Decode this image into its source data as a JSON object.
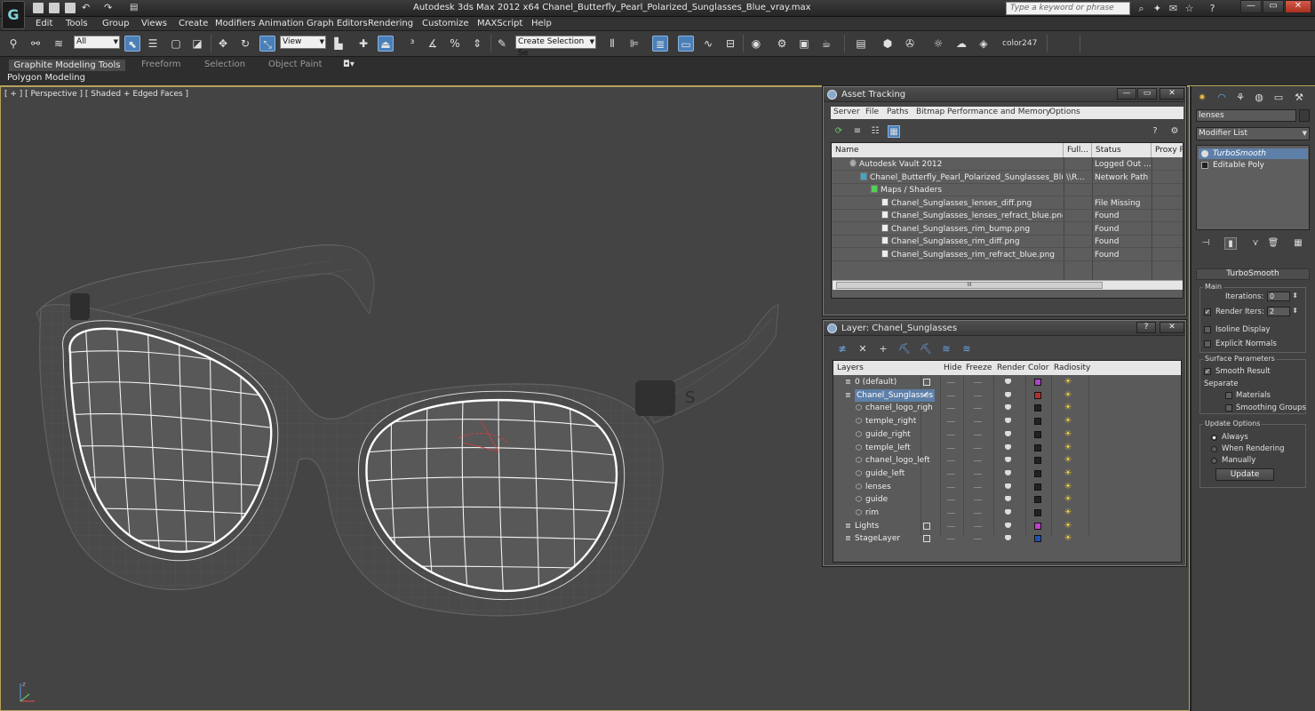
{
  "app": {
    "logo_text": "G",
    "window_title": "Autodesk 3ds Max  2012 x64      Chanel_Butterfly_Pearl_Polarized_Sunglasses_Blue_vray.max",
    "search_placeholder": "Type a keyword or phrase",
    "window_buttons": {
      "minimize": "—",
      "maximize": "▭",
      "close": "✕"
    }
  },
  "menu": [
    "Edit",
    "Tools",
    "Group",
    "Views",
    "Create",
    "Modifiers",
    "Animation",
    "Graph Editors",
    "Rendering",
    "Customize",
    "MAXScript",
    "Help"
  ],
  "toolbar": {
    "selection_filter": "All",
    "reference_coord": "View",
    "named_selection_set": "Create Selection Se",
    "color_label": "color247"
  },
  "ribbon": {
    "tabs": [
      "Graphite Modeling Tools",
      "Freeform",
      "Selection",
      "Object Paint"
    ],
    "active_tab": "Graphite Modeling Tools",
    "panel_label": "Polygon Modeling"
  },
  "viewport": {
    "label": "[ + ] [ Perspective ] [ Shaded + Edged Faces ]"
  },
  "command_panel": {
    "object_name": "lenses",
    "modifier_list_label": "Modifier List",
    "stack": [
      {
        "name": "TurboSmooth",
        "selected": true
      },
      {
        "name": "Editable Poly",
        "selected": false
      }
    ],
    "rollout_title": "TurboSmooth",
    "main_group": "Main",
    "iterations_label": "Iterations:",
    "iterations_value": "0",
    "render_iters_label": "Render Iters:",
    "render_iters_value": "2",
    "render_iters_checked": true,
    "isoline_label": "Isoline Display",
    "explicit_normals_label": "Explicit Normals",
    "surface_group": "Surface Parameters",
    "smooth_result_label": "Smooth Result",
    "separate_label": "Separate",
    "materials_label": "Materials",
    "smoothing_groups_label": "Smoothing Groups",
    "update_group": "Update Options",
    "update_options": [
      "Always",
      "When Rendering",
      "Manually"
    ],
    "update_selected": "Always",
    "update_button": "Update"
  },
  "asset_tracking": {
    "title": "Asset Tracking",
    "menu": [
      "Server",
      "File",
      "Paths",
      "Bitmap Performance and Memory",
      "Options"
    ],
    "columns": [
      "Name",
      "Full...",
      "Status",
      "Proxy R"
    ],
    "rows": [
      {
        "name": "Autodesk Vault 2012",
        "full": "",
        "status": "Logged Out ...",
        "indent": 1
      },
      {
        "name": "Chanel_Butterfly_Pearl_Polarized_Sunglasses_Blue_...",
        "full": "\\\\R...",
        "status": "Network Path",
        "indent": 2
      },
      {
        "name": "Maps / Shaders",
        "full": "",
        "status": "",
        "indent": 3
      },
      {
        "name": "Chanel_Sunglasses_lenses_diff.png",
        "full": "",
        "status": "File Missing",
        "indent": 4
      },
      {
        "name": "Chanel_Sunglasses_lenses_refract_blue.png",
        "full": "",
        "status": "Found",
        "indent": 4
      },
      {
        "name": "Chanel_Sunglasses_rim_bump.png",
        "full": "",
        "status": "Found",
        "indent": 4
      },
      {
        "name": "Chanel_Sunglasses_rim_diff.png",
        "full": "",
        "status": "Found",
        "indent": 4
      },
      {
        "name": "Chanel_Sunglasses_rim_refract_blue.png",
        "full": "",
        "status": "Found",
        "indent": 4
      }
    ],
    "scroll_thumb": "III"
  },
  "layer_dialog": {
    "title": "Layer: Chanel_Sunglasses",
    "columns": [
      "Layers",
      "Hide",
      "Freeze",
      "Render",
      "Color",
      "Radiosity"
    ],
    "rows": [
      {
        "name": "0 (default)",
        "level": 0,
        "color": "#b044c8",
        "checkbox": true,
        "current": false,
        "selected": false
      },
      {
        "name": "Chanel_Sunglasses",
        "level": 0,
        "color": "#b33030",
        "checkbox": false,
        "current": true,
        "selected": true
      },
      {
        "name": "chanel_logo_righ",
        "level": 1,
        "color": "#222222",
        "checkbox": false,
        "current": false,
        "selected": false
      },
      {
        "name": "temple_right",
        "level": 1,
        "color": "#222222",
        "checkbox": false,
        "current": false,
        "selected": false
      },
      {
        "name": "guide_right",
        "level": 1,
        "color": "#222222",
        "checkbox": false,
        "current": false,
        "selected": false
      },
      {
        "name": "temple_left",
        "level": 1,
        "color": "#222222",
        "checkbox": false,
        "current": false,
        "selected": false
      },
      {
        "name": "chanel_logo_left",
        "level": 1,
        "color": "#222222",
        "checkbox": false,
        "current": false,
        "selected": false
      },
      {
        "name": "guide_left",
        "level": 1,
        "color": "#222222",
        "checkbox": false,
        "current": false,
        "selected": false
      },
      {
        "name": "lenses",
        "level": 1,
        "color": "#222222",
        "checkbox": false,
        "current": false,
        "selected": false
      },
      {
        "name": "guide",
        "level": 1,
        "color": "#222222",
        "checkbox": false,
        "current": false,
        "selected": false
      },
      {
        "name": "rim",
        "level": 1,
        "color": "#222222",
        "checkbox": false,
        "current": false,
        "selected": false
      },
      {
        "name": "Lights",
        "level": 0,
        "color": "#c040d0",
        "checkbox": true,
        "current": false,
        "selected": false
      },
      {
        "name": "StageLayer",
        "level": 0,
        "color": "#2050b0",
        "checkbox": true,
        "current": false,
        "selected": false
      }
    ]
  },
  "colors": {
    "accent": "#4a7fb8",
    "viewport_bg": "#444444",
    "viewport_border": "#b6a15a"
  }
}
